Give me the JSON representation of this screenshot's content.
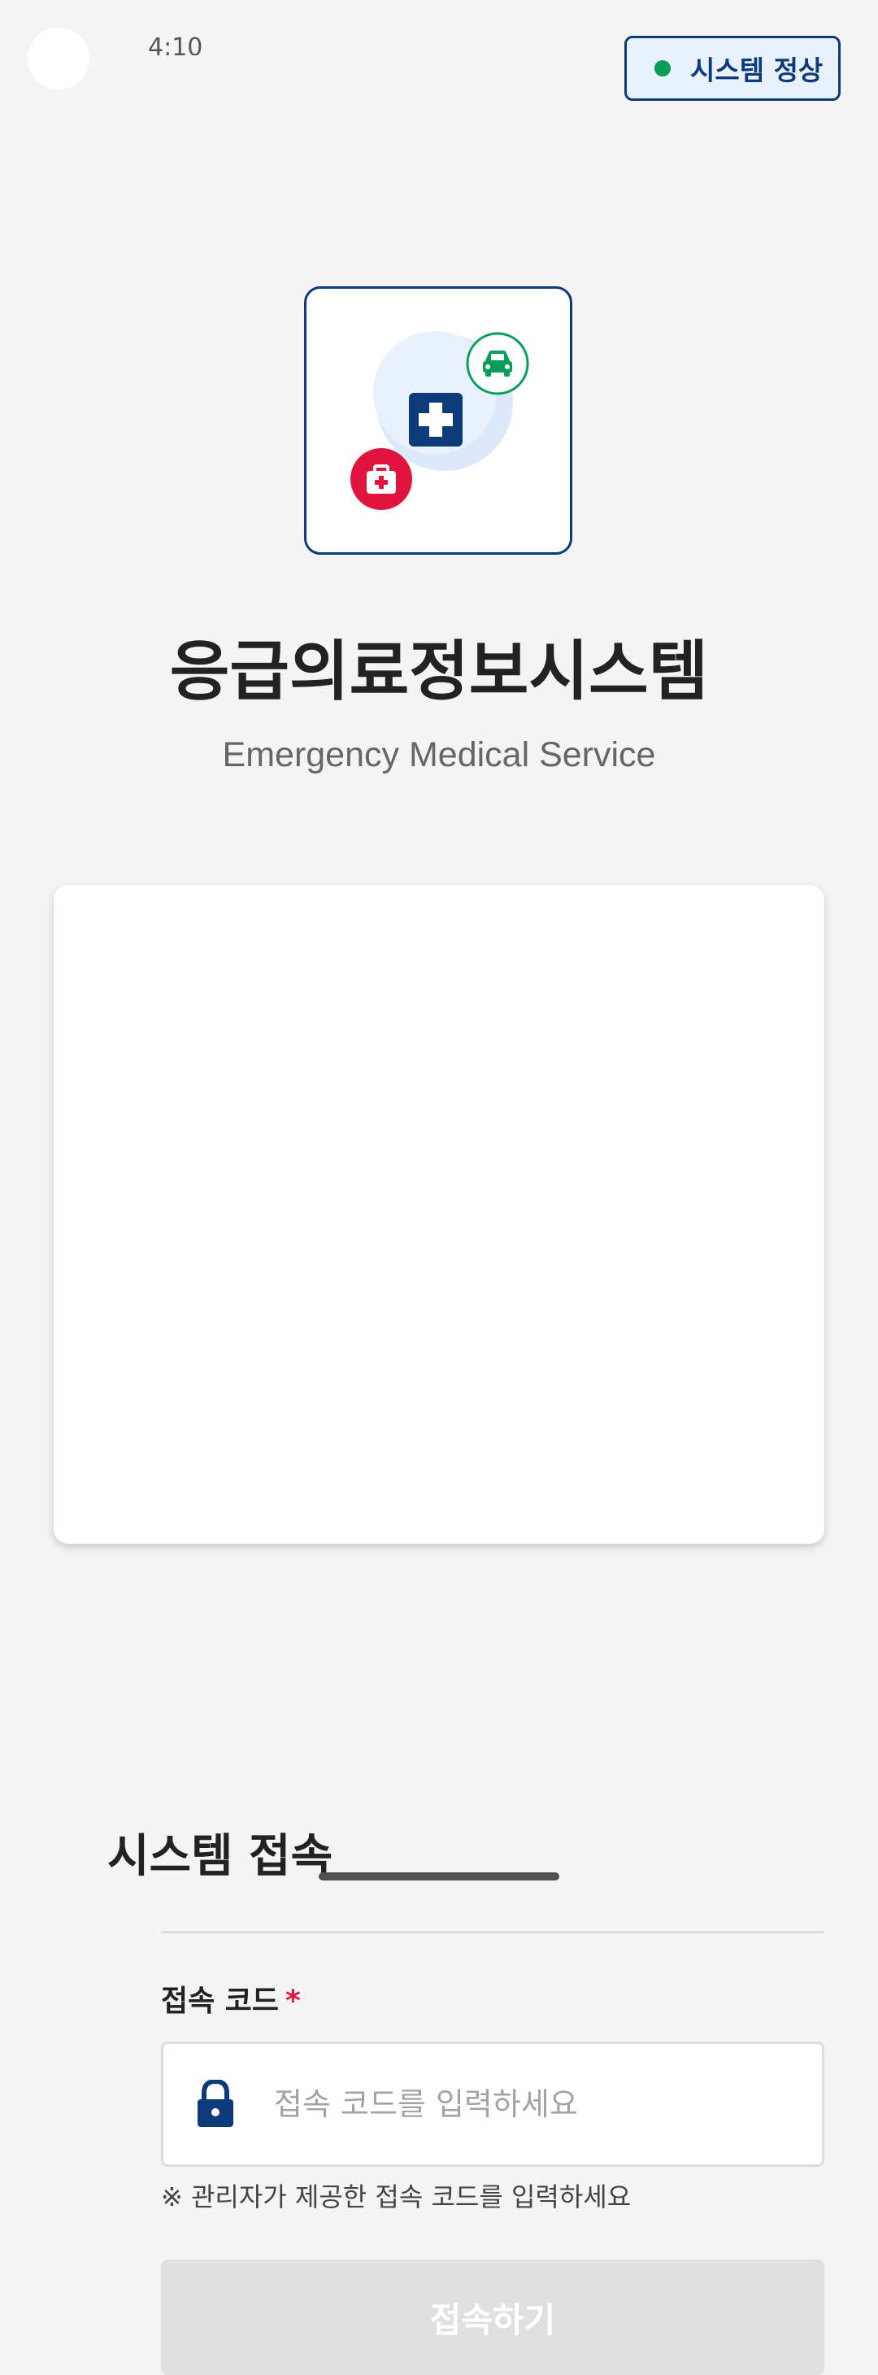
{
  "status_bar": {
    "time": "4:10"
  },
  "system_badge": {
    "label": "시스템 정상",
    "color": "#0a9d58"
  },
  "logo": {
    "icons": [
      "medical-cross-icon",
      "car-icon",
      "first-aid-kit-icon"
    ],
    "colors": {
      "primary": "#0d3b7a",
      "car": "#0a9d58",
      "kit": "#e0143c"
    }
  },
  "header": {
    "title": "응급의료정보시스템",
    "subtitle": "Emergency Medical Service"
  },
  "login_card": {
    "title": "시스템 접속",
    "field_label": "접속 코드",
    "required_mark": "*",
    "input_value": "",
    "input_placeholder": "접속 코드를 입력하세요",
    "helper_text": "※ 관리자가 제공한 접속 코드를 입력하세요",
    "submit_label": "접속하기",
    "icon": "lock-icon"
  },
  "colors": {
    "brand": "#0d3b7a",
    "required": "#e0143c",
    "button_disabled": "#e0e0e0"
  }
}
